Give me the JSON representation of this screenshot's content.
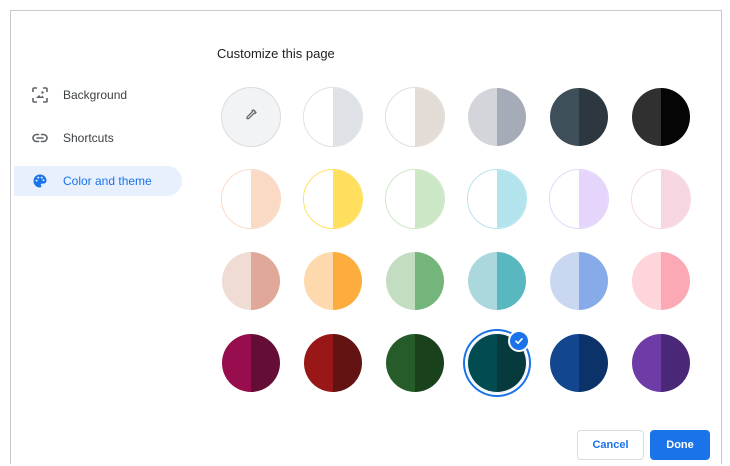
{
  "dialog": {
    "title": "Customize this page",
    "cancel_label": "Cancel",
    "done_label": "Done"
  },
  "nav": {
    "items": [
      {
        "label": "Background",
        "icon": "background-image-icon",
        "selected": false
      },
      {
        "label": "Shortcuts",
        "icon": "link-icon",
        "selected": false
      },
      {
        "label": "Color and theme",
        "icon": "palette-icon",
        "selected": true
      }
    ]
  },
  "themes": {
    "custom_icon": "eyedropper-icon",
    "selected_index": 21,
    "swatches": [
      {
        "left": "#ffffff",
        "right": "#dee1e6"
      },
      {
        "left": "#ffffff",
        "right": "#e3dcd6"
      },
      {
        "left": "#d3d5da",
        "right": "#a5abb7"
      },
      {
        "left": "#3f4f5a",
        "right": "#2c3740"
      },
      {
        "left": "#303030",
        "right": "#050505"
      },
      {
        "left": "#ffffff",
        "right": "#fad9c5"
      },
      {
        "left": "#ffffff",
        "right": "#ffdf5d"
      },
      {
        "left": "#ffffff",
        "right": "#cce7c5"
      },
      {
        "left": "#ffffff",
        "right": "#b3e4ee"
      },
      {
        "left": "#ffffff",
        "right": "#e5d5fb"
      },
      {
        "left": "#ffffff",
        "right": "#f6d7e1"
      },
      {
        "left": "#efdcd5",
        "right": "#e0a898"
      },
      {
        "left": "#fdd9ad",
        "right": "#fdac3e"
      },
      {
        "left": "#c3ddc2",
        "right": "#73b57a"
      },
      {
        "left": "#abd8dc",
        "right": "#58b7bf"
      },
      {
        "left": "#c9d7f1",
        "right": "#86abe8"
      },
      {
        "left": "#fdd5db",
        "right": "#fba9b4"
      },
      {
        "left": "#970d4d",
        "right": "#640e36"
      },
      {
        "left": "#9a1717",
        "right": "#641313"
      },
      {
        "left": "#265c29",
        "right": "#19411c"
      },
      {
        "left": "#024c51",
        "right": "#073a3d"
      },
      {
        "left": "#12468f",
        "right": "#0c326a"
      },
      {
        "left": "#6e3ca6",
        "right": "#4b2877"
      }
    ]
  }
}
